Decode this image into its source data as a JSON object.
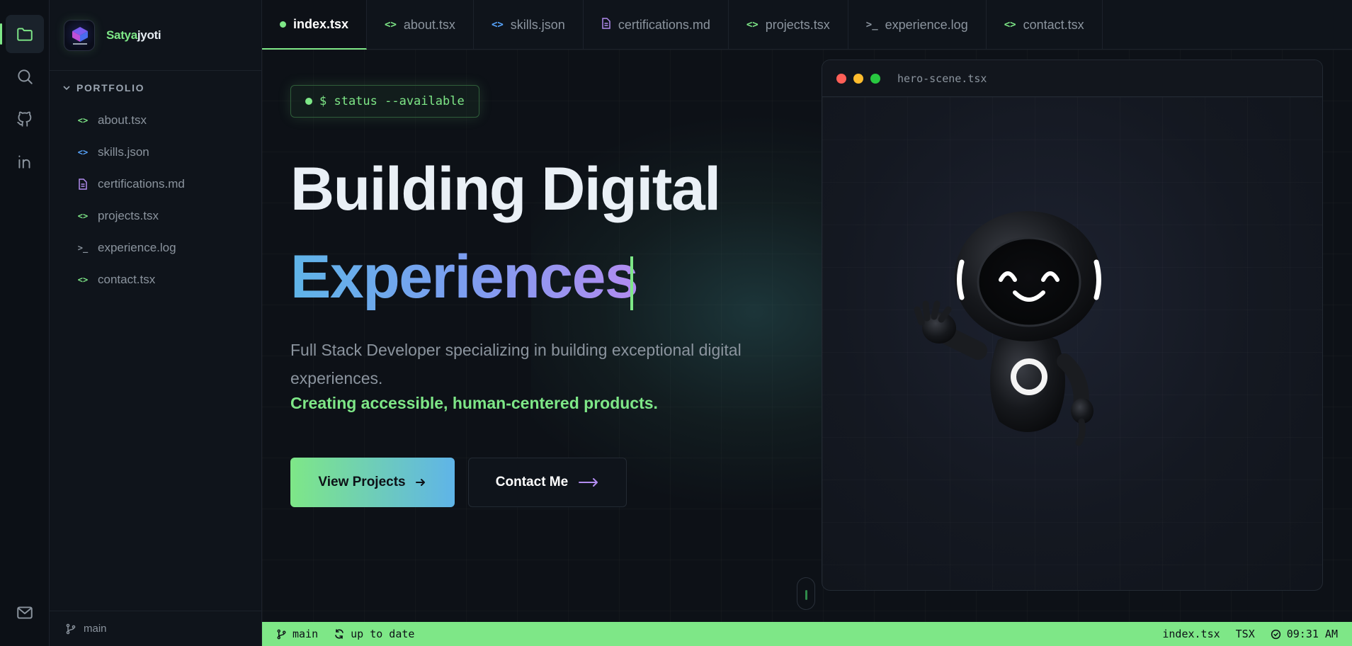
{
  "brand": {
    "name_part1": "Satya",
    "name_part2": "jyoti"
  },
  "activity_bar": {
    "items": [
      {
        "icon": "files-icon"
      },
      {
        "icon": "search-icon"
      },
      {
        "icon": "github-icon"
      },
      {
        "icon": "linkedin-icon"
      },
      {
        "icon": "mail-icon"
      }
    ]
  },
  "sidebar": {
    "folder_label": "PORTFOLIO",
    "items": [
      {
        "label": "about.tsx",
        "icon": "code-icon",
        "color": "#7ee787"
      },
      {
        "label": "skills.json",
        "icon": "code-icon",
        "color": "#58a6ff"
      },
      {
        "label": "certifications.md",
        "icon": "document-icon",
        "color": "#b28cf0"
      },
      {
        "label": "projects.tsx",
        "icon": "code-icon",
        "color": "#7ee787"
      },
      {
        "label": "experience.log",
        "icon": "terminal-icon",
        "color": "#8b949e"
      },
      {
        "label": "contact.tsx",
        "icon": "code-icon",
        "color": "#7ee787"
      }
    ],
    "branch": "main"
  },
  "tabs": [
    {
      "label": "index.tsx",
      "active": true
    },
    {
      "label": "about.tsx",
      "icon": "code-icon",
      "color": "#7ee787"
    },
    {
      "label": "skills.json",
      "icon": "code-icon",
      "color": "#58a6ff"
    },
    {
      "label": "certifications.md",
      "icon": "document-icon",
      "color": "#b28cf0"
    },
    {
      "label": "projects.tsx",
      "icon": "code-icon",
      "color": "#7ee787"
    },
    {
      "label": "experience.log",
      "icon": "terminal-icon",
      "color": "#8b949e"
    },
    {
      "label": "contact.tsx",
      "icon": "code-icon",
      "color": "#7ee787"
    }
  ],
  "hero": {
    "status": "$ status --available",
    "heading_line1": "Building Digital",
    "heading_line2": "Experiences",
    "lead": "Full Stack Developer specializing in building exceptional digital experiences.",
    "accent": "Creating accessible, human-centered products.",
    "primary_button": "View Projects",
    "secondary_button": "Contact Me"
  },
  "scene": {
    "title": "hero-scene.tsx"
  },
  "statusbar": {
    "branch": "main",
    "sync": "up to date",
    "file": "index.tsx",
    "language": "TSX",
    "time": "09:31 AM"
  },
  "colors": {
    "accent": "#7ee787",
    "blue": "#58a6ff",
    "purple": "#b28cf0",
    "bg": "#0d1117"
  }
}
